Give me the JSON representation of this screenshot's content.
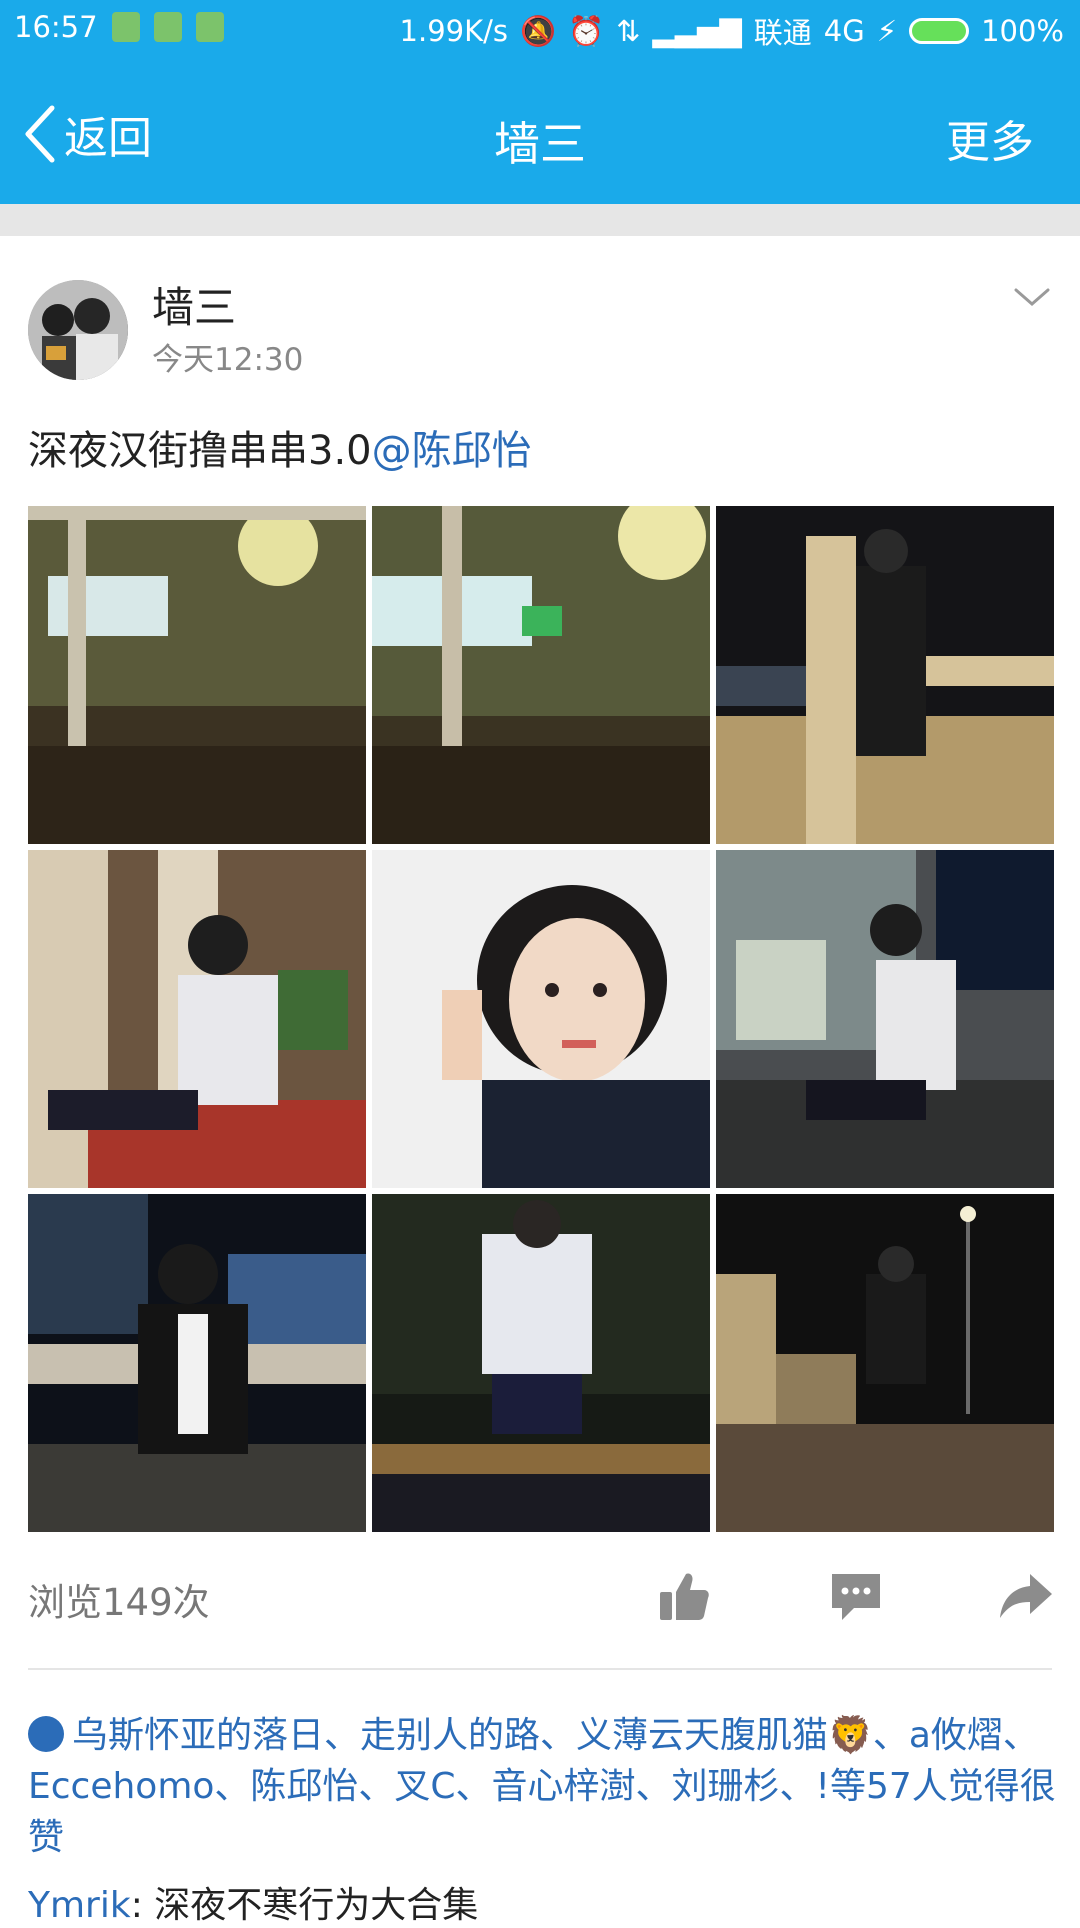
{
  "status_bar": {
    "time": "16:57",
    "network_speed": "1.99K/s",
    "carrier": "联通",
    "network_type": "4G",
    "battery": "100%"
  },
  "nav": {
    "back_label": "返回",
    "title": "墙三",
    "more_label": "更多"
  },
  "post": {
    "author": "墙三",
    "time": "今天12:30",
    "text": "深夜汉街撸串串3.0",
    "mention": "@陈邱怡",
    "views": "浏览149次",
    "likes_text": "乌斯怀亚的落日、走别人的路、义薄云天腹肌猫🦁、a攸熠、Eccehomo、陈邱怡、叉C、音心梓澍、刘珊杉、!等57人觉得很赞",
    "comment_user": "Ymrik",
    "comment_text": ": 深夜不寒行为大合集"
  },
  "colors": {
    "header_blue": "#1aaaea",
    "link_blue": "#2b6cb8"
  }
}
